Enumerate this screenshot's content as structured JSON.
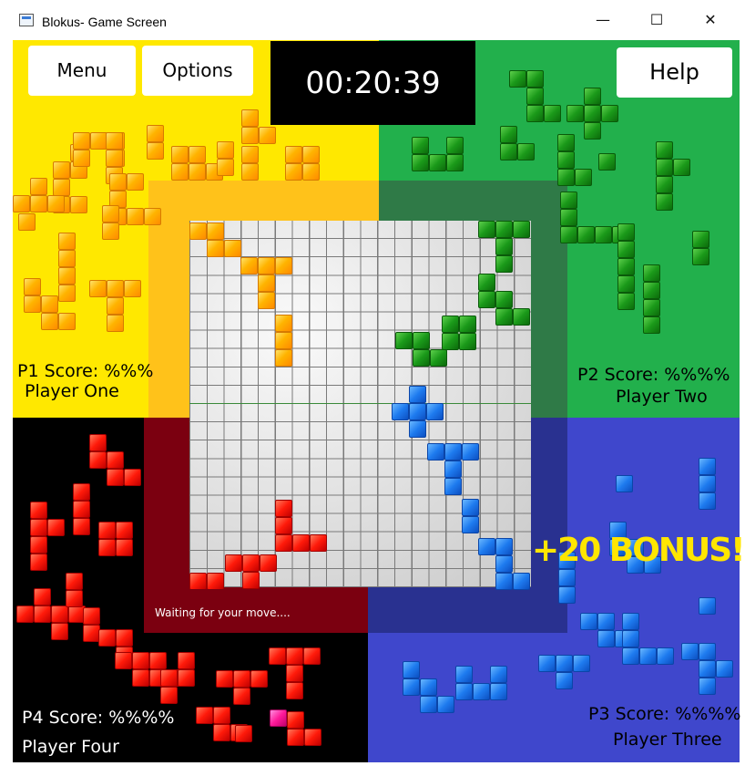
{
  "window": {
    "title": "Blokus- Game Screen",
    "minimize_glyph": "—",
    "maximize_glyph": "☐",
    "close_glyph": "✕"
  },
  "buttons": {
    "menu": "Menu",
    "options": "Options",
    "help": "Help"
  },
  "timer": "00:20:39",
  "players": {
    "p1": {
      "score_label": "P1 Score: %%%",
      "name": "Player One",
      "color": "#ffe800"
    },
    "p2": {
      "score_label": "P2 Score: %%%%",
      "name": "Player Two",
      "color": "#22b04c"
    },
    "p3": {
      "score_label": "P3 Score: %%%%",
      "name": "Player Three",
      "color": "#3f47cc"
    },
    "p4": {
      "score_label": "P4 Score: %%%%",
      "name": "Player Four",
      "color": "#000000"
    }
  },
  "status": "Waiting for your move....",
  "bonus": "+20 BONUS!",
  "board": {
    "columns": 20,
    "rows": 20
  }
}
